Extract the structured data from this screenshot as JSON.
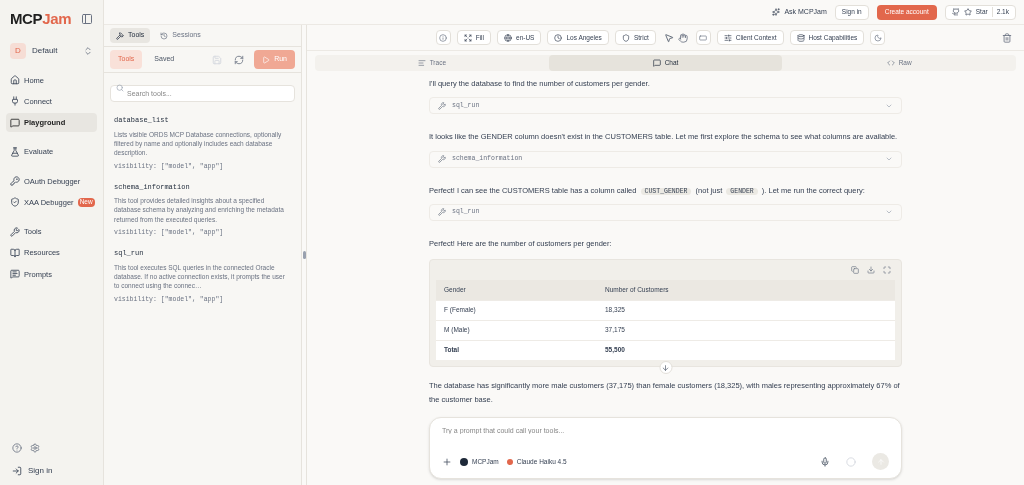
{
  "logo": {
    "first": "MCP",
    "second": "Jam"
  },
  "workspace": {
    "initial": "D",
    "name": "Default"
  },
  "nav_groups": [
    [
      {
        "label": "Home",
        "selected": false
      },
      {
        "label": "Connect",
        "selected": false
      },
      {
        "label": "Playground",
        "selected": true
      }
    ],
    [
      {
        "label": "Evaluate",
        "selected": false
      }
    ],
    [
      {
        "label": "OAuth Debugger",
        "selected": false
      },
      {
        "label": "XAA Debugger",
        "selected": false,
        "badge": "New"
      }
    ],
    [
      {
        "label": "Tools",
        "selected": false
      },
      {
        "label": "Resources",
        "selected": false
      },
      {
        "label": "Prompts",
        "selected": false
      }
    ]
  ],
  "sidebar_footer": {
    "sign_in": "Sign in"
  },
  "header": {
    "ask": "Ask MCPJam",
    "sign_in": "Sign in",
    "create": "Create account",
    "star": "Star",
    "stars_count": "2.1k"
  },
  "panel_tabs": [
    {
      "label": "Tools",
      "selected": true
    },
    {
      "label": "Sessions",
      "selected": false
    }
  ],
  "sub_tabs": [
    {
      "label": "Tools",
      "selected": true
    },
    {
      "label": "Saved",
      "selected": false
    }
  ],
  "run_button": "Run",
  "search": {
    "placeholder": "Search tools..."
  },
  "tools": [
    {
      "name": "database_list",
      "description": "Lists visible ORDS MCP Database connections, optionally filtered by name and optionally includes each database description.",
      "visibility": "visibility: [\"model\", \"app\"]"
    },
    {
      "name": "schema_information",
      "description": "This tool provides detailed insights about a specified database schema by analyzing and enriching the metadata returned from the executed queries.",
      "visibility": "visibility: [\"model\", \"app\"]"
    },
    {
      "name": "sql_run",
      "description": "This tool executes SQL queries in the connected Oracle database. If no active connection exists, it prompts the user to connect using the connec…",
      "visibility": "visibility: [\"model\", \"app\"]"
    }
  ],
  "toolbar": [
    {
      "kind": "icon"
    },
    {
      "kind": "chip",
      "label": "Fill"
    },
    {
      "kind": "chip",
      "label": "en-US"
    },
    {
      "kind": "chip",
      "label": "Los Angeles"
    },
    {
      "kind": "chip",
      "label": "Strict"
    },
    {
      "kind": "pair"
    },
    {
      "kind": "icon"
    },
    {
      "kind": "chip",
      "label": "Client Context"
    },
    {
      "kind": "chip",
      "label": "Host Capabilities"
    },
    {
      "kind": "icon"
    }
  ],
  "view_tabs": [
    {
      "label": "Trace",
      "selected": false
    },
    {
      "label": "Chat",
      "selected": true
    },
    {
      "label": "Raw",
      "selected": false
    }
  ],
  "messages": [
    {
      "kind": "text",
      "parts": [
        {
          "kind": "text",
          "text": "I'll query the database to find the number of customers per gender."
        }
      ]
    },
    {
      "kind": "tool",
      "name": "sql_run"
    },
    {
      "kind": "text",
      "parts": [
        {
          "kind": "text",
          "text": "It looks like the GENDER column doesn't exist in the CUSTOMERS table. Let me first explore the schema to see what columns are available."
        }
      ]
    },
    {
      "kind": "tool",
      "name": "schema_information"
    },
    {
      "kind": "text",
      "parts": [
        {
          "kind": "text",
          "text": "Perfect! I can see the CUSTOMERS table has a column called"
        },
        {
          "kind": "code",
          "text": "CUST_GENDER"
        },
        {
          "kind": "text",
          "text": "(not just"
        },
        {
          "kind": "code",
          "text": "GENDER"
        },
        {
          "kind": "text",
          "text": "). Let me run the correct query:"
        }
      ]
    },
    {
      "kind": "tool",
      "name": "sql_run"
    },
    {
      "kind": "text",
      "parts": [
        {
          "kind": "text",
          "text": "Perfect! Here are the number of customers per gender:"
        }
      ]
    },
    {
      "kind": "table",
      "columns": [
        "Gender",
        "Number of Customers"
      ],
      "rows": [
        [
          "F (Female)",
          "18,325"
        ],
        [
          "M (Male)",
          "37,175"
        ]
      ],
      "total": [
        "Total",
        "55,500"
      ]
    },
    {
      "kind": "text",
      "parts": [
        {
          "kind": "text",
          "text": "The database has significantly more male customers (37,175) than female customers (18,325), with males representing approximately 67% of the customer base."
        }
      ]
    }
  ],
  "composer": {
    "placeholder": "Try a prompt that could call your tools...",
    "server": "MCPJam",
    "model": "Claude Haiku 4.5"
  }
}
